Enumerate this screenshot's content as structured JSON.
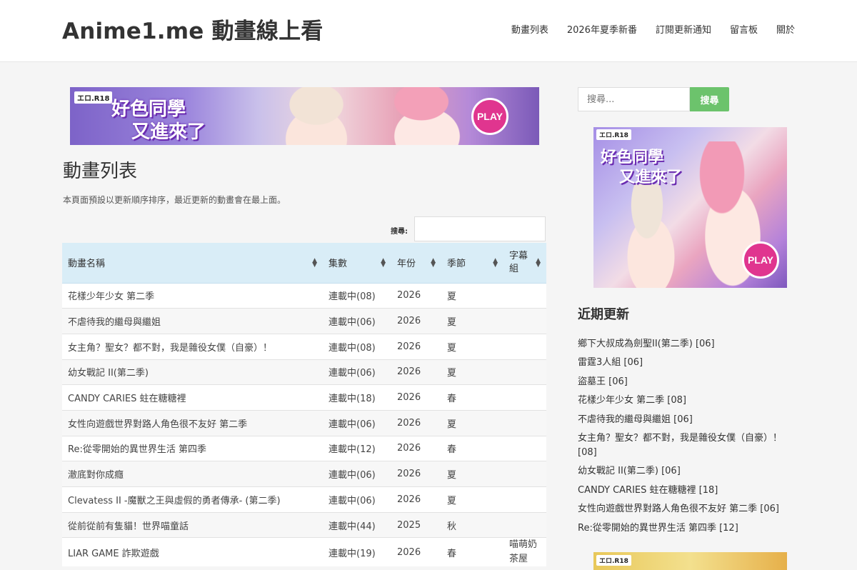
{
  "site": {
    "title": "Anime1.me 動畫線上看"
  },
  "nav": {
    "items": [
      "動畫列表",
      "2026年夏季新番",
      "訂閱更新通知",
      "留言板",
      "關於"
    ]
  },
  "banner": {
    "badge": "エロ.R18",
    "title_line1": "好色同學",
    "title_line2": "又進來了",
    "play": "PLAY"
  },
  "main": {
    "page_title": "動畫列表",
    "description": "本頁面預設以更新順序排序，最近更新的動畫會在最上面。",
    "search_label": "搜尋:",
    "search_value": ""
  },
  "table": {
    "headers": [
      "動畫名稱",
      "集數",
      "年份",
      "季節",
      "字幕組"
    ],
    "rows": [
      [
        "花樣少年少女 第二季",
        "連載中(08)",
        "2026",
        "夏",
        ""
      ],
      [
        "不虐待我的繼母與繼姐",
        "連載中(06)",
        "2026",
        "夏",
        ""
      ],
      [
        "女主角？聖女？都不對，我是雜役女僕（自豪）！",
        "連載中(08)",
        "2026",
        "夏",
        ""
      ],
      [
        "幼女戰記 II(第二季)",
        "連載中(06)",
        "2026",
        "夏",
        ""
      ],
      [
        "CANDY CARIES 蛀在糖糖裡",
        "連載中(18)",
        "2026",
        "春",
        ""
      ],
      [
        "女性向遊戲世界對路人角色很不友好 第二季",
        "連載中(06)",
        "2026",
        "夏",
        ""
      ],
      [
        "Re:從零開始的異世界生活 第四季",
        "連載中(12)",
        "2026",
        "春",
        ""
      ],
      [
        "澈底對你成癮",
        "連載中(06)",
        "2026",
        "夏",
        ""
      ],
      [
        "Clevatess II -魔獸之王與虛假的勇者傳承- (第二季)",
        "連載中(06)",
        "2026",
        "夏",
        ""
      ],
      [
        "從前從前有隻貓！世界喵童話",
        "連載中(44)",
        "2025",
        "秋",
        ""
      ],
      [
        "LIAR GAME 詐欺遊戲",
        "連載中(19)",
        "2026",
        "春",
        "喵萌奶茶屋"
      ]
    ]
  },
  "sidebar": {
    "search_placeholder": "搜尋...",
    "search_button": "搜尋",
    "recent_title": "近期更新",
    "recent": [
      "鄉下大叔成為劍聖II(第二季) [06]",
      "雷霆3人組 [06]",
      "盜墓王 [06]",
      "花樣少年少女 第二季 [08]",
      "不虐待我的繼母與繼姐 [06]",
      "女主角？聖女？都不對，我是雜役女僕（自豪）！[08]",
      "幼女戰記 II(第二季) [06]",
      "CANDY CARIES 蛀在糖糖裡 [18]",
      "女性向遊戲世界對路人角色很不友好 第二季 [06]",
      "Re:從零開始的異世界生活 第四季 [12]"
    ]
  },
  "colors": {
    "header_bg": "#ffffff",
    "page_bg": "#f5f5f5",
    "table_header_bg": "#d9edf7",
    "search_button_bg": "#6cc36c",
    "play_button": "#e0358f"
  }
}
